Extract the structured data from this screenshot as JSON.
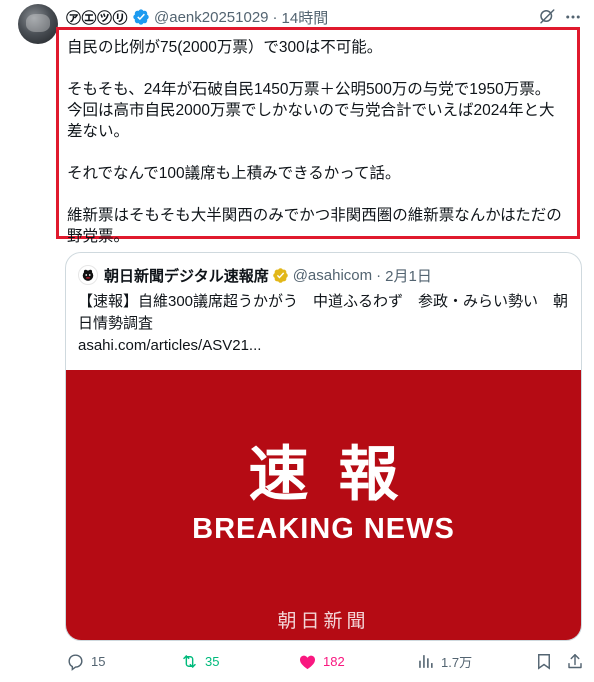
{
  "author": {
    "display_name": "㋐㋓㋡㋷",
    "handle": "@aenk20251029",
    "separator": "·",
    "time": "14時間"
  },
  "tweet": {
    "lines": [
      "自民の比例が75(2000万票）で300は不可能。",
      "",
      "そもそも、24年が石破自民1450万票＋公明500万の与党で1950万票。",
      "今回は高市自民2000万票でしかないので与党合計でいえば2024年と大差ない。",
      "",
      "それでなんで100議席も上積みできるかって話。",
      "",
      "維新票はそもそも大半関西のみでかつ非関西圏の維新票なんかはただの野党票。"
    ]
  },
  "quote": {
    "display_name": "朝日新聞デジタル速報席",
    "handle": "@asahicom",
    "separator": "·",
    "time": "2月1日",
    "text": "【速報】自維300議席超うかがう　中道ふるわず　参政・みらい勢い　朝日情勢調査",
    "link": "asahi.com/articles/ASV21...",
    "card": {
      "title": "速報",
      "subtitle": "BREAKING NEWS",
      "brand": "朝日新聞",
      "background": "#b50b14"
    }
  },
  "actions": {
    "reply_count": "15",
    "retweet_count": "35",
    "like_count": "182",
    "views_count": "1.7万"
  },
  "colors": {
    "highlight_border": "#e0192d",
    "verified_blue": "#1d9bf0",
    "verified_gold": "#e2b719",
    "retweet_green": "#00ba7c",
    "like_pink": "#f91880",
    "secondary_text": "#536471"
  },
  "icons": [
    "grok-icon",
    "more-icon",
    "reply-icon",
    "retweet-icon",
    "like-icon",
    "views-icon",
    "bookmark-icon",
    "share-icon"
  ]
}
